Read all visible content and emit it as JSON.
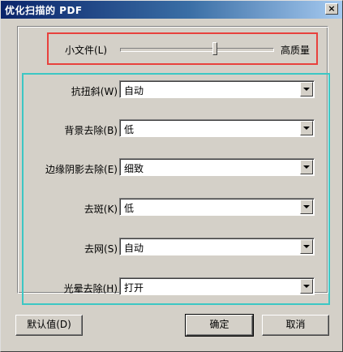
{
  "window": {
    "title": "优化扫描的 PDF",
    "close_glyph": "×"
  },
  "quality": {
    "left_label": "小文件(L)",
    "right_label": "高质量",
    "slider_value_fraction": 0.62
  },
  "settings": [
    {
      "label": "抗扭斜(W)：",
      "value": "自动"
    },
    {
      "label": "背景去除(B)：",
      "value": "低"
    },
    {
      "label": "边缘阴影去除(E)：",
      "value": "细致"
    },
    {
      "label": "去斑(K)：",
      "value": "低"
    },
    {
      "label": "去网(S)：",
      "value": "自动"
    },
    {
      "label": "光晕去除(H)：",
      "value": "打开"
    }
  ],
  "buttons": {
    "default_label": "默认值(D)",
    "ok_label": "确定",
    "cancel_label": "取消"
  },
  "colors": {
    "highlight_red": "#e8413d",
    "highlight_cyan": "#3cc7c4",
    "titlebar": "#0a246a"
  }
}
